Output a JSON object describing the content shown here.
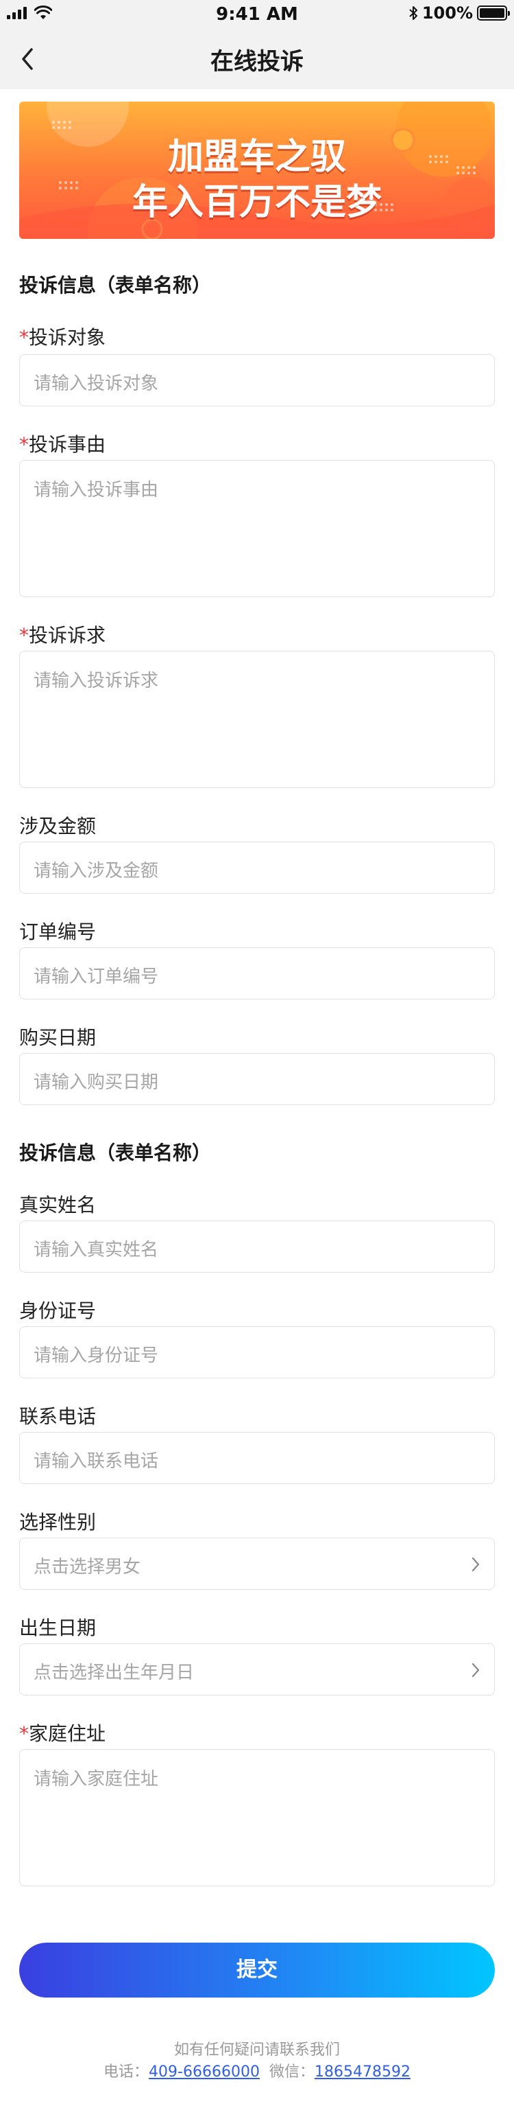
{
  "status_bar": {
    "time": "9:41 AM",
    "battery": "100%"
  },
  "nav": {
    "title": "在线投诉"
  },
  "banner": {
    "line1": "加盟车之驭",
    "line2": "年入百万不是梦"
  },
  "sections": [
    {
      "title": "投诉信息（表单名称）"
    },
    {
      "title": "投诉信息（表单名称）"
    }
  ],
  "fields": {
    "target": {
      "label": "投诉对象",
      "required": "*",
      "placeholder": "请输入投诉对象"
    },
    "reason": {
      "label": "投诉事由",
      "required": "*",
      "placeholder": "请输入投诉事由"
    },
    "demand": {
      "label": "投诉诉求",
      "required": "*",
      "placeholder": "请输入投诉诉求"
    },
    "amount": {
      "label": "涉及金额",
      "placeholder": "请输入涉及金额"
    },
    "order_no": {
      "label": "订单编号",
      "placeholder": "请输入订单编号"
    },
    "purchase_date": {
      "label": "购买日期",
      "placeholder": "请输入购买日期"
    },
    "real_name": {
      "label": "真实姓名",
      "placeholder": "请输入真实姓名"
    },
    "id_no": {
      "label": "身份证号",
      "placeholder": "请输入身份证号"
    },
    "phone": {
      "label": "联系电话",
      "placeholder": "请输入联系电话"
    },
    "gender": {
      "label": "选择性别",
      "placeholder": "点击选择男女"
    },
    "birth_date": {
      "label": "出生日期",
      "placeholder": "点击选择出生年月日"
    },
    "address": {
      "label": "家庭住址",
      "required": "*",
      "placeholder": "请输入家庭住址"
    }
  },
  "submit": {
    "label": "提交"
  },
  "footer": {
    "line1": "如有任何疑问请联系我们",
    "phone_label": "电话：",
    "phone": "409-66666000",
    "wechat_label": "微信：",
    "wechat": "1865478592"
  },
  "colors": {
    "required": "#e8353b",
    "submit_gradient_start": "#3a3fe0",
    "submit_gradient_end": "#00c6ff",
    "link": "#2f5fe8",
    "banner_orange": "#ff7a3a"
  }
}
